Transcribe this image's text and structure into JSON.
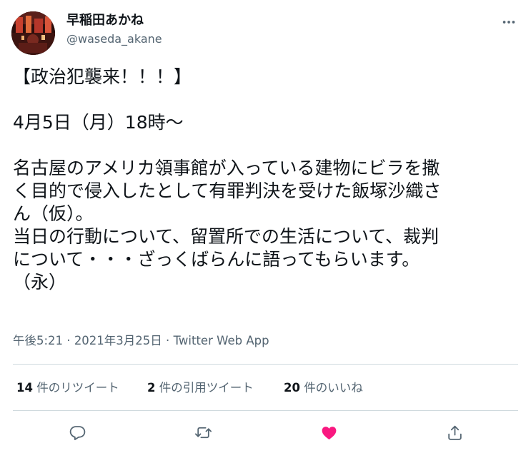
{
  "user": {
    "display_name": "早稲田あかね",
    "handle": "@waseda_akane",
    "avatar_icon": "profile-avatar"
  },
  "tweet": {
    "lines": [
      "【政治犯襲来！！！】",
      "",
      "4月5日（月）18時～",
      "",
      "名古屋のアメリカ領事館が入っている建物にビラを撒",
      "く目的で侵入したとして有罪判決を受けた飯塚沙織さ",
      "ん（仮）。",
      "当日の行動について、留置所での生活について、裁判",
      "について・・・ざっくばらんに語ってもらいます。",
      "（永）"
    ]
  },
  "meta": {
    "time": "午後5:21",
    "separator1": " · ",
    "date": "2021年3月25日",
    "separator2": " · ",
    "source": "Twitter Web App"
  },
  "stats": {
    "retweets": {
      "count": "14",
      "label": " 件のリツイート"
    },
    "quotes": {
      "count": "2",
      "label": " 件の引用ツイート"
    },
    "likes": {
      "count": "20",
      "label": " 件のいいね"
    }
  },
  "actions": {
    "reply_icon": "reply-icon",
    "retweet_icon": "retweet-icon",
    "like_icon": "heart-icon",
    "share_icon": "share-icon"
  },
  "colors": {
    "text": "#0f1419",
    "secondary": "#536471",
    "divider": "#cfd9de",
    "like": "#f91880"
  }
}
